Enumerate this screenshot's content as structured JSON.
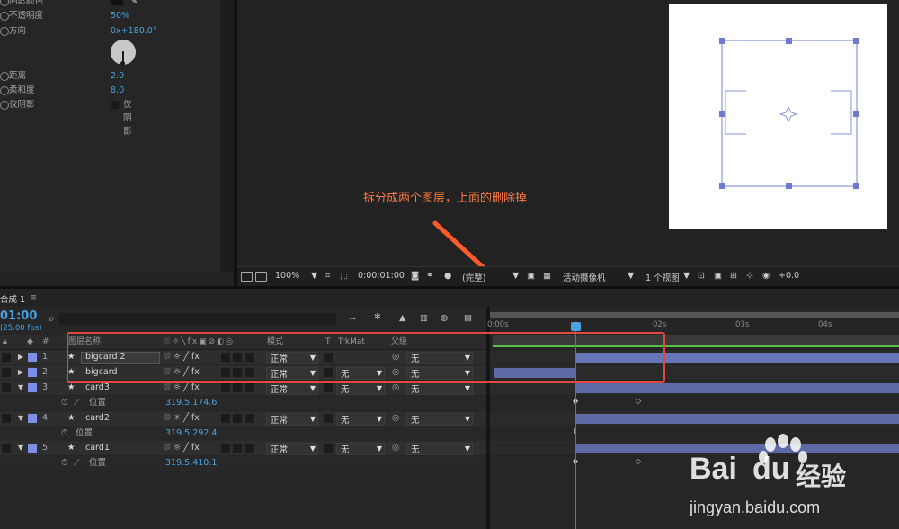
{
  "effects": {
    "rows": [
      {
        "label": "阴影颜色",
        "value": ""
      },
      {
        "label": "不透明度",
        "value": "50%"
      },
      {
        "label": "方向",
        "value": "0x+180.0°"
      },
      {
        "label": "距离",
        "value": "2.0"
      },
      {
        "label": "柔和度",
        "value": "8.0"
      },
      {
        "label": "仅阴影",
        "value": "仅阴影"
      }
    ]
  },
  "viewer_toolbar": {
    "zoom": "100%",
    "timecode": "0:00:01:00",
    "quality": "(完整)",
    "camera": "活动摄像机",
    "views": "1 个视图",
    "exposure": "+0.0"
  },
  "annotation": "拆分成两个图层，上面的删除掉",
  "timeline": {
    "comp_tab": "合成 1",
    "menu_glyph": "≡",
    "current_time": "01:00",
    "fps": "25.00 fps",
    "search_icon": "⌕",
    "columns": {
      "num": "#",
      "layer_name": "图层名称",
      "mode": "模式",
      "t": "T",
      "trkmat": "TrkMat",
      "parent": "父级"
    },
    "ruler_ticks": [
      "0:00s",
      "02s",
      "03s",
      "04s"
    ],
    "layers": [
      {
        "num": "1",
        "name": "bigcard 2",
        "mode": "正常",
        "trkmat": "",
        "parent": "无",
        "expanded": false
      },
      {
        "num": "2",
        "name": "bigcard",
        "mode": "正常",
        "trkmat": "无",
        "parent": "无",
        "expanded": false
      },
      {
        "num": "3",
        "name": "card3",
        "mode": "正常",
        "trkmat": "无",
        "parent": "无",
        "expanded": true,
        "prop_label": "位置",
        "prop_value": "319.5,174.6"
      },
      {
        "num": "4",
        "name": "card2",
        "mode": "正常",
        "trkmat": "无",
        "parent": "无",
        "expanded": true,
        "prop_label": "位置",
        "prop_value": "319.5,292.4"
      },
      {
        "num": "5",
        "name": "card1",
        "mode": "正常",
        "trkmat": "无",
        "parent": "无",
        "expanded": true,
        "prop_label": "位置",
        "prop_value": "319.5,410.1"
      }
    ]
  },
  "watermark": {
    "brand": "Bai",
    "brand2": "du",
    "cn": "经验",
    "url": "jingyan.baidu.com"
  },
  "colors": {
    "accent_blue": "#4aa3e0",
    "layer_label": "#7f8fe8",
    "annotation": "#ff5a2a",
    "playhead": "#e04040",
    "bar": "#5d6aa6"
  }
}
